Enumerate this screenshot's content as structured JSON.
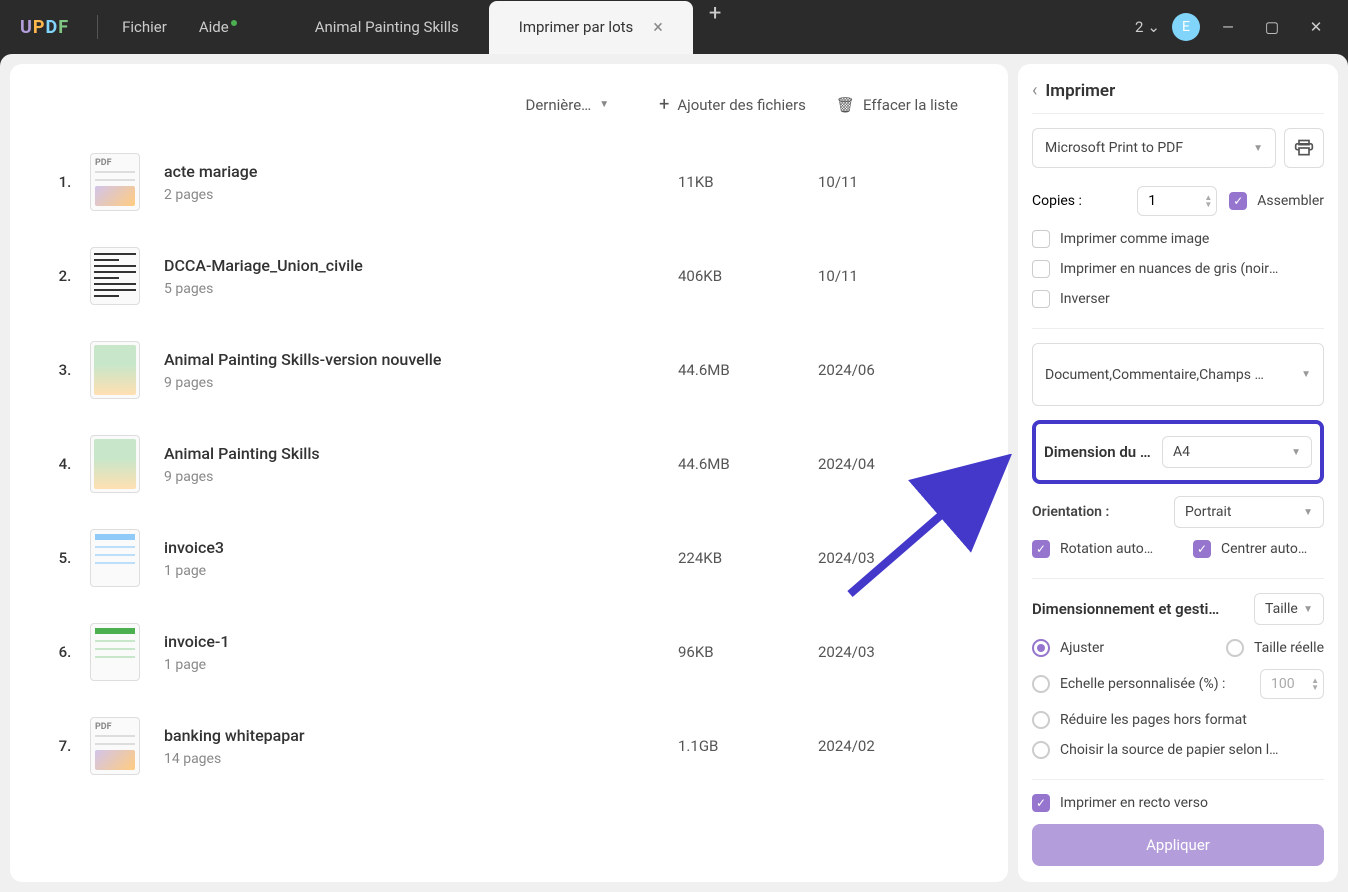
{
  "titlebar": {
    "menu_file": "Fichier",
    "menu_help": "Aide",
    "tab1": "Animal Painting Skills",
    "tab2": "Imprimer par lots",
    "user_count": "2",
    "avatar_letter": "E"
  },
  "toolbar": {
    "sort_label": "Dernière…",
    "add_label": "Ajouter des fichiers",
    "clear_label": "Effacer la liste"
  },
  "files": [
    {
      "idx": "1.",
      "name": "acte mariage",
      "pages": "2 pages",
      "size": "11KB",
      "date": "10/11",
      "thumb": "pdf"
    },
    {
      "idx": "2.",
      "name": "DCCA-Mariage_Union_civile",
      "pages": "5 pages",
      "size": "406KB",
      "date": "10/11",
      "thumb": "doc"
    },
    {
      "idx": "3.",
      "name": "Animal Painting Skills-version nouvelle",
      "pages": "9 pages",
      "size": "44.6MB",
      "date": "2024/06",
      "thumb": "img"
    },
    {
      "idx": "4.",
      "name": "Animal Painting Skills",
      "pages": "9 pages",
      "size": "44.6MB",
      "date": "2024/04",
      "thumb": "img"
    },
    {
      "idx": "5.",
      "name": "invoice3",
      "pages": "1 page",
      "size": "224KB",
      "date": "2024/03",
      "thumb": "inv"
    },
    {
      "idx": "6.",
      "name": "invoice-1",
      "pages": "1 page",
      "size": "96KB",
      "date": "2024/03",
      "thumb": "inv2"
    },
    {
      "idx": "7.",
      "name": "banking whitepapar",
      "pages": "14 pages",
      "size": "1.1GB",
      "date": "2024/02",
      "thumb": "pdf"
    }
  ],
  "side": {
    "title": "Imprimer",
    "printer": "Microsoft Print to PDF",
    "copies_label": "Copies :",
    "copies_value": "1",
    "assemble": "Assembler",
    "print_as_image": "Imprimer comme image",
    "grayscale": "Imprimer en nuances de gris (noir et …",
    "invert": "Inverser",
    "content_select": "Document,Commentaire,Champs …",
    "dim_label": "Dimension du …",
    "dim_value": "A4",
    "orient_label": "Orientation :",
    "orient_value": "Portrait",
    "auto_rotate": "Rotation auto…",
    "auto_center": "Centrer auto…",
    "sizing_title": "Dimensionnement et gesti…",
    "sizing_select": "Taille",
    "fit": "Ajuster",
    "actual": "Taille réelle",
    "custom_scale": "Echelle personnalisée (%) :",
    "custom_scale_value": "100",
    "shrink": "Réduire les pages hors format",
    "paper_source": "Choisir la source de papier selon le f…",
    "duplex": "Imprimer en recto verso",
    "apply": "Appliquer"
  }
}
